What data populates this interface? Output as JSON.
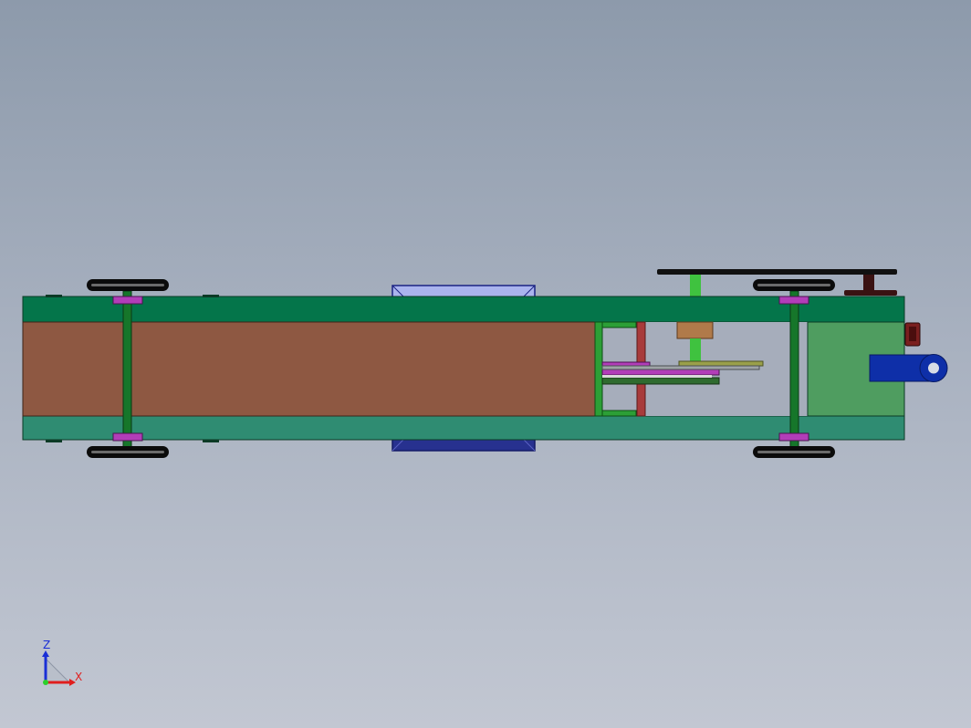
{
  "view": {
    "orientation": "top view",
    "background_top": "#8d9aab",
    "background_bottom": "#c2c7d2"
  },
  "triad": {
    "z_label": "Z",
    "x_label": "X",
    "z_color": "#1a2fd6",
    "x_color": "#e01e1e"
  },
  "colors": {
    "chassis_green": "#04754a",
    "chassis_green_light": "#2f8c72",
    "deck_brown": "#8e5842",
    "axle_green": "#16762a",
    "wheel_black": "#0b0b0b",
    "bearing_purple": "#b23db8",
    "block_light_blue": "#aab4ee",
    "block_dark_blue": "#27318f",
    "motor_blue": "#0e2fa8",
    "panel_green": "#4f9d60",
    "shaft_lime": "#3fc23f",
    "rod_red": "#a83b3b",
    "gearbox_tan": "#b07a4a"
  },
  "icons": [
    "axis-triad-icon"
  ]
}
